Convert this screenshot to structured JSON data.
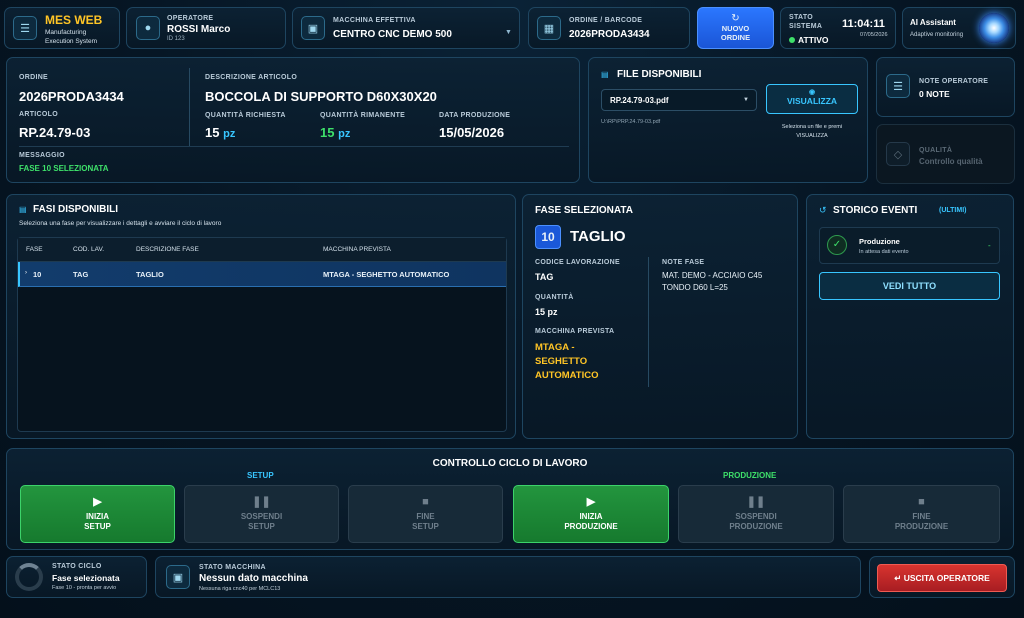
{
  "header": {
    "app_name": "MES WEB",
    "app_sub1": "Manufacturing",
    "app_sub2": "Execution System",
    "operator_label": "OPERATORE",
    "operator_name": "ROSSI Marco",
    "operator_id": "ID 123",
    "machine_label": "MACCHINA EFFETTIVA",
    "machine_value": "CENTRO CNC DEMO 500",
    "order_label": "ORDINE / BARCODE",
    "order_value": "2026PRODA3434",
    "new_order_line1": "NUOVO",
    "new_order_line2": "ORDINE",
    "status_label1": "STATO",
    "status_label2": "SISTEMA",
    "status_value": "ATTIVO",
    "time": "11:04:11",
    "date": "07/05/2026",
    "ai_title": "AI Assistant",
    "ai_sub": "Adaptive monitoring"
  },
  "order_info": {
    "order_label": "ORDINE",
    "order_value": "2026PRODA3434",
    "desc_label": "DESCRIZIONE ARTICOLO",
    "desc_value": "BOCCOLA DI SUPPORTO D60X30X20",
    "article_label": "ARTICOLO",
    "article_value": "RP.24.79-03",
    "qty_req_label": "QUANTITÀ RICHIESTA",
    "qty_req_value": "15",
    "qty_rem_label": "QUANTITÀ RIMANENTE",
    "qty_rem_value": "15",
    "unit": "pz",
    "date_label": "DATA PRODUZIONE",
    "date_value": "15/05/2026",
    "msg_label": "MESSAGGIO",
    "msg_value": "FASE 10 SELEZIONATA"
  },
  "files": {
    "title": "FILE DISPONIBILI",
    "selected_file": "RP.24.79-03.pdf",
    "path": "U:\\RP\\PRP.24.79-03.pdf",
    "view_button": "VISUALIZZA",
    "hint_line1": "Seleziona un file e premi",
    "hint_line2": "VISUALIZZA"
  },
  "notes": {
    "label": "NOTE OPERATORE",
    "value": "0 NOTE",
    "quality_label": "QUALITÀ",
    "quality_sub": "Controllo qualità"
  },
  "phases": {
    "title": "FASI DISPONIBILI",
    "subtitle": "Seleziona una fase per visualizzare i dettagli e avviare il ciclo di lavoro",
    "columns": [
      "FASE",
      "COD. LAV.",
      "DESCRIZIONE FASE",
      "MACCHINA PREVISTA"
    ],
    "rows": [
      {
        "fase": "10",
        "cod": "TAG",
        "desc": "TAGLIO",
        "machine": "MTAGA - SEGHETTO AUTOMATICO"
      }
    ]
  },
  "selected_phase": {
    "title": "FASE SELEZIONATA",
    "number": "10",
    "name": "TAGLIO",
    "code_label": "CODICE LAVORAZIONE",
    "code_value": "TAG",
    "qty_label": "QUANTITÀ",
    "qty_value": "15 pz",
    "machine_label": "MACCHINA PREVISTA",
    "machine_line1": "MTAGA -",
    "machine_line2": "SEGHETTO",
    "machine_line3": "AUTOMATICO",
    "notes_label": "NOTE FASE",
    "notes_line1": "MAT. DEMO - ACCIAIO C45",
    "notes_line2": "TONDO D60 L=25"
  },
  "history": {
    "title": "STORICO EVENTI",
    "badge": "(ULTIMI)",
    "event_title": "Produzione",
    "event_sub": "In attesa dati evento",
    "event_value": "-",
    "see_all": "VEDI TUTTO"
  },
  "cycle": {
    "title": "CONTROLLO CICLO DI LAVORO",
    "setup_label": "SETUP",
    "prod_label": "PRODUZIONE",
    "buttons": [
      {
        "l1": "INIZIA",
        "l2": "SETUP"
      },
      {
        "l1": "SOSPENDI",
        "l2": "SETUP"
      },
      {
        "l1": "FINE",
        "l2": "SETUP"
      },
      {
        "l1": "INIZIA",
        "l2": "PRODUZIONE"
      },
      {
        "l1": "SOSPENDI",
        "l2": "PRODUZIONE"
      },
      {
        "l1": "FINE",
        "l2": "PRODUZIONE"
      }
    ]
  },
  "footer": {
    "cycle_label": "STATO CICLO",
    "cycle_value": "Fase selezionata",
    "cycle_sub": "Fase 10 - pronta per avvio",
    "machine_label": "STATO MACCHINA",
    "machine_value": "Nessun dato macchina",
    "machine_sub": "Nessuna riga cnc40 per MCLC13",
    "exit_button": "USCITA OPERATORE"
  },
  "colors": {
    "accent": "#38c6ff",
    "active_green": "#3ee06a",
    "machine_gold": "#ffc526",
    "primary_blue": "#1e63e8",
    "exit_red": "#c8262a"
  },
  "icons": [
    "menu-icon",
    "operator-icon",
    "machine-icon",
    "barcode-icon",
    "refresh-icon",
    "chevron-down-icon",
    "file-icon",
    "eye-icon",
    "notes-icon",
    "quality-icon",
    "list-icon",
    "history-icon",
    "check-icon",
    "play-icon",
    "pause-icon",
    "stop-icon",
    "ring-icon",
    "chip-icon",
    "exit-icon",
    "ai-orb-icon"
  ]
}
